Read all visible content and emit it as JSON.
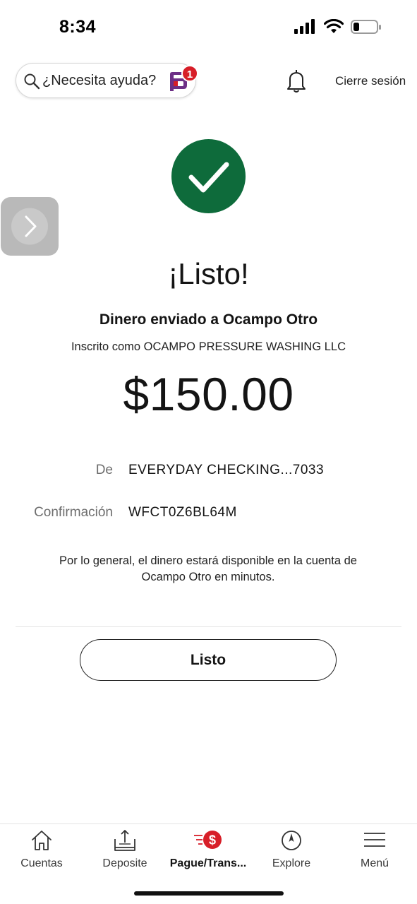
{
  "status_bar": {
    "time": "8:34"
  },
  "header": {
    "help_label": "¿Necesita ayuda?",
    "assistant_badge_count": "1",
    "signout_label": "Cierre sesión"
  },
  "confirmation": {
    "title": "¡Listo!",
    "recipient_line": "Dinero enviado a Ocampo Otro",
    "enrolled_line": "Inscrito como OCAMPO PRESSURE WASHING LLC",
    "amount": "$150.00",
    "details": [
      {
        "label": "De",
        "value": "EVERYDAY CHECKING...7033"
      },
      {
        "label": "Confirmación",
        "value": "WFCT0Z6BL64M"
      }
    ],
    "note": "Por lo general, el dinero estará disponible en la cuenta de Ocampo Otro en minutos.",
    "done_button_label": "Listo"
  },
  "tabbar": {
    "tabs": [
      {
        "label": "Cuentas",
        "icon": "home-icon",
        "active": false
      },
      {
        "label": "Deposite",
        "icon": "deposit-icon",
        "active": false
      },
      {
        "label": "Pague/Trans...",
        "icon": "pay-transfer-icon",
        "active": true
      },
      {
        "label": "Explore",
        "icon": "compass-icon",
        "active": false
      },
      {
        "label": "Menú",
        "icon": "hamburger-menu-icon",
        "active": false
      }
    ]
  },
  "colors": {
    "success_green": "#0e6b3b",
    "brand_red": "#d71e28",
    "assistant_purple": "#6d2f86"
  }
}
